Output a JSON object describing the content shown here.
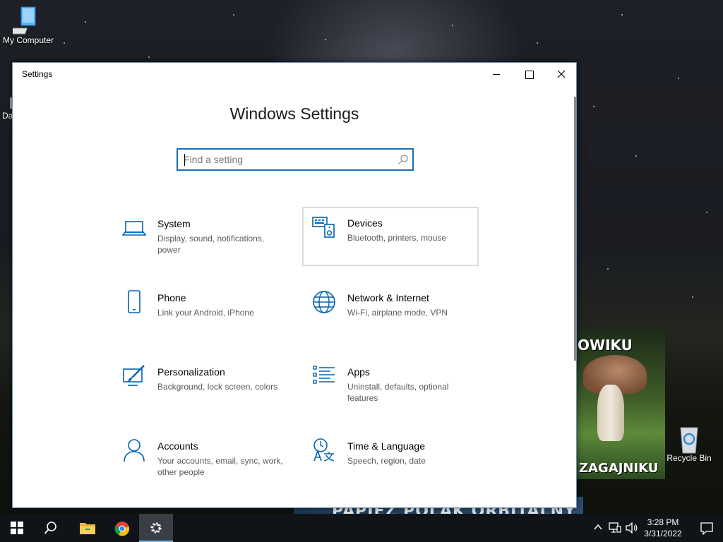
{
  "desktop": {
    "icons": [
      {
        "label": "My Computer"
      },
      {
        "label": "Recycle Bin"
      }
    ],
    "partial_label": "Da",
    "poster": {
      "top_text": "OWIKU",
      "bottom_text": "ZAGAJNIKU",
      "banner_text": "PAPIEŻ POLAK ORBITALNY"
    }
  },
  "window": {
    "title": "Settings",
    "heading": "Windows Settings",
    "search": {
      "placeholder": "Find a setting",
      "value": ""
    },
    "accent_color": "#0063b1",
    "categories": [
      {
        "name": "System",
        "desc": "Display, sound, notifications, power",
        "icon": "laptop-icon"
      },
      {
        "name": "Devices",
        "desc": "Bluetooth, printers, mouse",
        "icon": "devices-icon"
      },
      {
        "name": "Phone",
        "desc": "Link your Android, iPhone",
        "icon": "phone-icon"
      },
      {
        "name": "Network & Internet",
        "desc": "Wi-Fi, airplane mode, VPN",
        "icon": "globe-icon"
      },
      {
        "name": "Personalization",
        "desc": "Background, lock screen, colors",
        "icon": "paintbrush-icon"
      },
      {
        "name": "Apps",
        "desc": "Uninstall, defaults, optional features",
        "icon": "apps-list-icon"
      },
      {
        "name": "Accounts",
        "desc": "Your accounts, email, sync, work, other people",
        "icon": "person-icon"
      },
      {
        "name": "Time & Language",
        "desc": "Speech, region, date",
        "icon": "time-language-icon"
      }
    ]
  },
  "taskbar": {
    "clock": {
      "time": "3:28 PM",
      "date": "3/31/2022"
    }
  }
}
